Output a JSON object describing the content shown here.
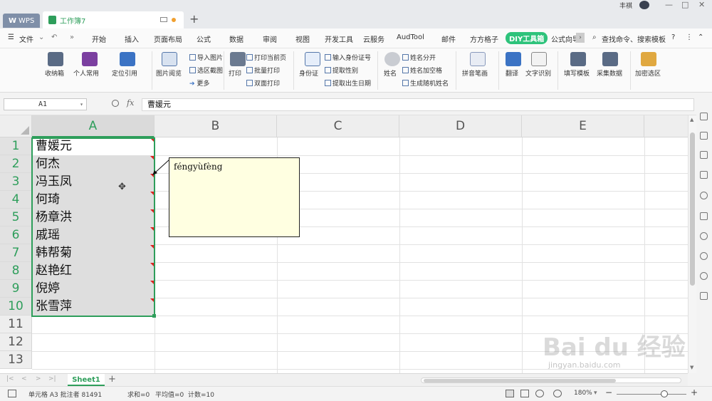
{
  "titlebar": {
    "app_tab": "WPS",
    "doc_tab": "工作簿7",
    "user": "丰祺"
  },
  "menu": {
    "items": [
      "文件",
      "开始",
      "插入",
      "页面布局",
      "公式",
      "数据",
      "审阅",
      "视图",
      "开发工具",
      "云服务",
      "AudTool",
      "邮件",
      "方方格子",
      "DIY工具箱",
      "公式向导"
    ],
    "active": "DIY工具箱",
    "search_placeholder": "查找命令、搜索模板",
    "help": "?"
  },
  "ribbon": {
    "buttons": {
      "inbox": "收纳箱",
      "personal": "个人常用",
      "locate": "定位引用",
      "pic_view": "图片阅览",
      "import_pic": "导入图片",
      "select_capture": "选区截图",
      "more": "更多",
      "print": "打印",
      "print_current": "打印当前页",
      "batch_print": "批量打印",
      "duplex_print": "双面打印",
      "idcard": "身份证",
      "input_id": "输入身份证号",
      "get_gender": "提取性别",
      "get_birth": "提取出生日期",
      "name": "姓名",
      "split_name": "姓名分开",
      "name_space": "姓名加空格",
      "random_name": "生成随机姓名",
      "pinyin": "拼音笔画",
      "translate": "翻译",
      "ocr": "文字识别",
      "fill_template": "填写模板",
      "collect_data": "采集数据",
      "encrypt": "加密选区"
    }
  },
  "formula": {
    "cell_ref": "A1",
    "fx": "fx",
    "content": "曹媛元"
  },
  "grid": {
    "columns": [
      "A",
      "B",
      "C",
      "D",
      "E"
    ],
    "rows": [
      "1",
      "2",
      "3",
      "4",
      "5",
      "6",
      "7",
      "8",
      "9",
      "10",
      "11",
      "12",
      "13"
    ],
    "cells": [
      "曹媛元",
      "何杰",
      "冯玉凤",
      "何琦",
      "杨章洪",
      "戚瑶",
      "韩帮菊",
      "赵艳红",
      "倪婷",
      "张雪萍"
    ],
    "comment": "féngyùfèng"
  },
  "sheets": {
    "tabs": [
      "Sheet1"
    ],
    "add": "+"
  },
  "status": {
    "cell_info": "单元格 A3 批注者 81491",
    "sum": "求和=0",
    "avg": "平均值=0",
    "count": "计数=10",
    "zoom": "180%",
    "minus": "−",
    "plus": "+"
  },
  "watermark": {
    "main": "Bai du 经验",
    "url": "jingyan.baidu.com"
  }
}
